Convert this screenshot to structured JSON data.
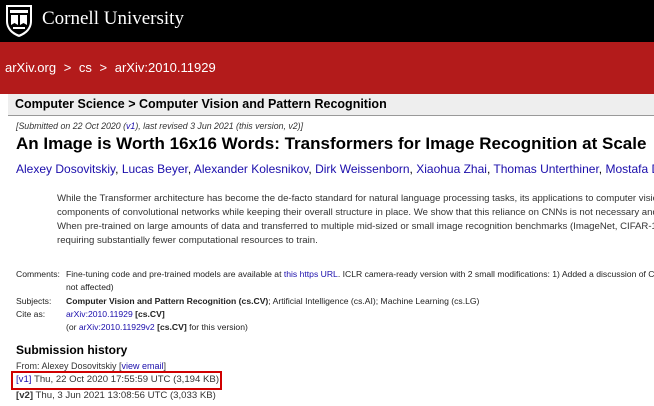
{
  "header": {
    "institution": "Cornell University"
  },
  "breadcrumb": {
    "items": [
      "arXiv.org",
      "cs",
      "arXiv:2010.11929"
    ],
    "separator": ">"
  },
  "subject_header": "Computer Science > Computer Vision and Pattern Recognition",
  "submission_note": {
    "prefix": "[Submitted on 22 Oct 2020 (",
    "v1_link": "v1",
    "suffix": "), last revised 3 Jun 2021 (this version, v2)]"
  },
  "paper": {
    "title": "An Image is Worth 16x16 Words: Transformers for Image Recognition at Scale",
    "authors": [
      "Alexey Dosovitskiy",
      "Lucas Beyer",
      "Alexander Kolesnikov",
      "Dirk Weissenborn",
      "Xiaohua Zhai",
      "Thomas Unterthiner",
      "Mostafa Deh"
    ],
    "abstract_lines": [
      "While the Transformer architecture has become the de-facto standard for natural language processing tasks, its applications to computer vision",
      "components of convolutional networks while keeping their overall structure in place. We show that this reliance on CNNs is not necessary and",
      "When pre-trained on large amounts of data and transferred to multiple mid-sized or small image recognition benchmarks (ImageNet, CIFAR-10",
      "requiring substantially fewer computational resources to train."
    ]
  },
  "metadata": {
    "comments_label": "Comments:",
    "comments_text1": "Fine-tuning code and pre-trained models are available at ",
    "comments_link": "this https URL",
    "comments_text2": ". ICLR camera-ready version with 2 small modifications: 1) Added a discussion of CL",
    "comments_line2": "not affected)",
    "subjects_label": "Subjects:",
    "subjects_primary": "Computer Vision and Pattern Recognition (cs.CV)",
    "subjects_rest": "; Artificial Intelligence (cs.AI); Machine Learning (cs.LG)",
    "cite_label": "Cite as:",
    "cite_id": "arXiv:2010.11929",
    "cite_cat": "[cs.CV]",
    "cite_or": "(or ",
    "cite_v2": "arXiv:2010.11929v2",
    "cite_v2_cat": "[cs.CV]",
    "cite_v2_suffix": " for this version)"
  },
  "history": {
    "title": "Submission history",
    "from_prefix": "From: Alexey Dosovitskiy [",
    "from_link": "view email",
    "from_suffix": "]",
    "v1_tag": "[v1]",
    "v1_date": " Thu, 22 Oct 2020 17:55:59 UTC (3,194 KB)",
    "v2_tag": "[v2]",
    "v2_date": " Thu, 3 Jun 2021 13:08:56 UTC (3,033 KB)"
  },
  "colors": {
    "header_bg": "#000000",
    "brand_red": "#b31b1b",
    "link": "#1a0dab",
    "highlight_box": "#d00000"
  }
}
